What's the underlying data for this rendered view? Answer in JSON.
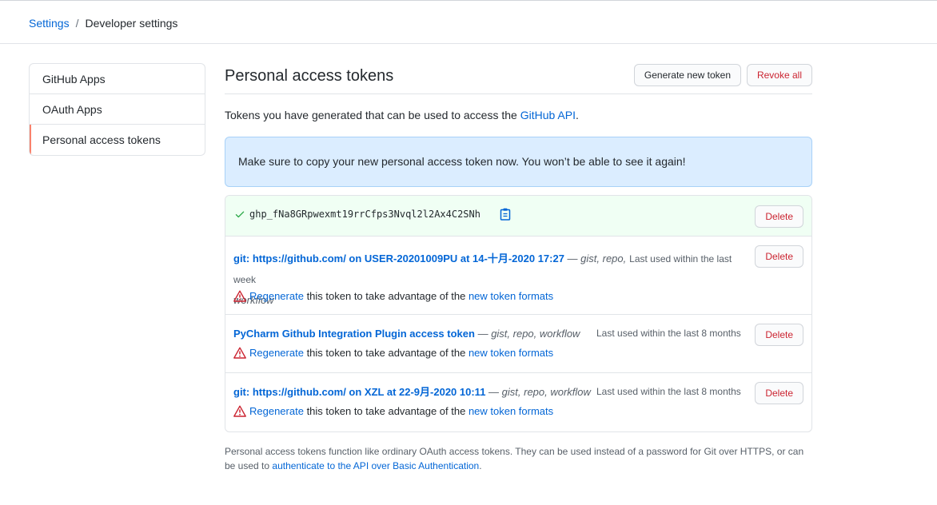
{
  "breadcrumb": {
    "parent": "Settings",
    "separator": "/",
    "current": "Developer settings"
  },
  "sidebar": {
    "items": [
      {
        "label": "GitHub Apps"
      },
      {
        "label": "OAuth Apps"
      },
      {
        "label": "Personal access tokens",
        "selected": true
      }
    ]
  },
  "page": {
    "title": "Personal access tokens",
    "generate_label": "Generate new token",
    "revoke_label": "Revoke all",
    "intro_text": "Tokens you have generated that can be used to access the ",
    "intro_link": "GitHub API",
    "intro_end": ".",
    "flash_message": "Make sure to copy your new personal access token now. You won’t be able to see it again!"
  },
  "new_token": {
    "value": "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",
    "delete_label": "Delete"
  },
  "tokens": [
    {
      "name": "git: https://github.com/ on USER-20201009PU at 14-十月-2020 17:27",
      "dash": " — ",
      "scopes_line1": "gist, repo,",
      "scopes_line2": "workflow",
      "last_used": "Last used within the last week",
      "delete_label": "Delete"
    },
    {
      "name": "PyCharm Github Integration Plugin access token",
      "dash": " — ",
      "scopes": "gist, repo, workflow",
      "last_used": "Last used within the last 8 months",
      "delete_label": "Delete"
    },
    {
      "name": "git: https://github.com/ on XZL at 22-9月-2020 10:11",
      "dash": " — ",
      "scopes": "gist, repo, workflow",
      "last_used": "Last used within the last 8 months",
      "delete_label": "Delete"
    }
  ],
  "regen": {
    "link": "Regenerate",
    "middle": " this token to take advantage of the ",
    "formats_link": "new token formats"
  },
  "footnote": {
    "text": "Personal access tokens function like ordinary OAuth access tokens. They can be used instead of a password for Git over HTTPS, or can be used to ",
    "link": "authenticate to the API over Basic Authentication",
    "end": "."
  },
  "icons": {
    "check": "check-icon",
    "clipboard": "clipboard-icon",
    "alert": "alert-icon"
  },
  "colors": {
    "link": "#0366d6",
    "danger": "#cb2431",
    "success": "#28a745",
    "flash_bg": "#dbedff",
    "new_token_bg": "#f0fff4",
    "selected_marker": "#f9826c"
  }
}
